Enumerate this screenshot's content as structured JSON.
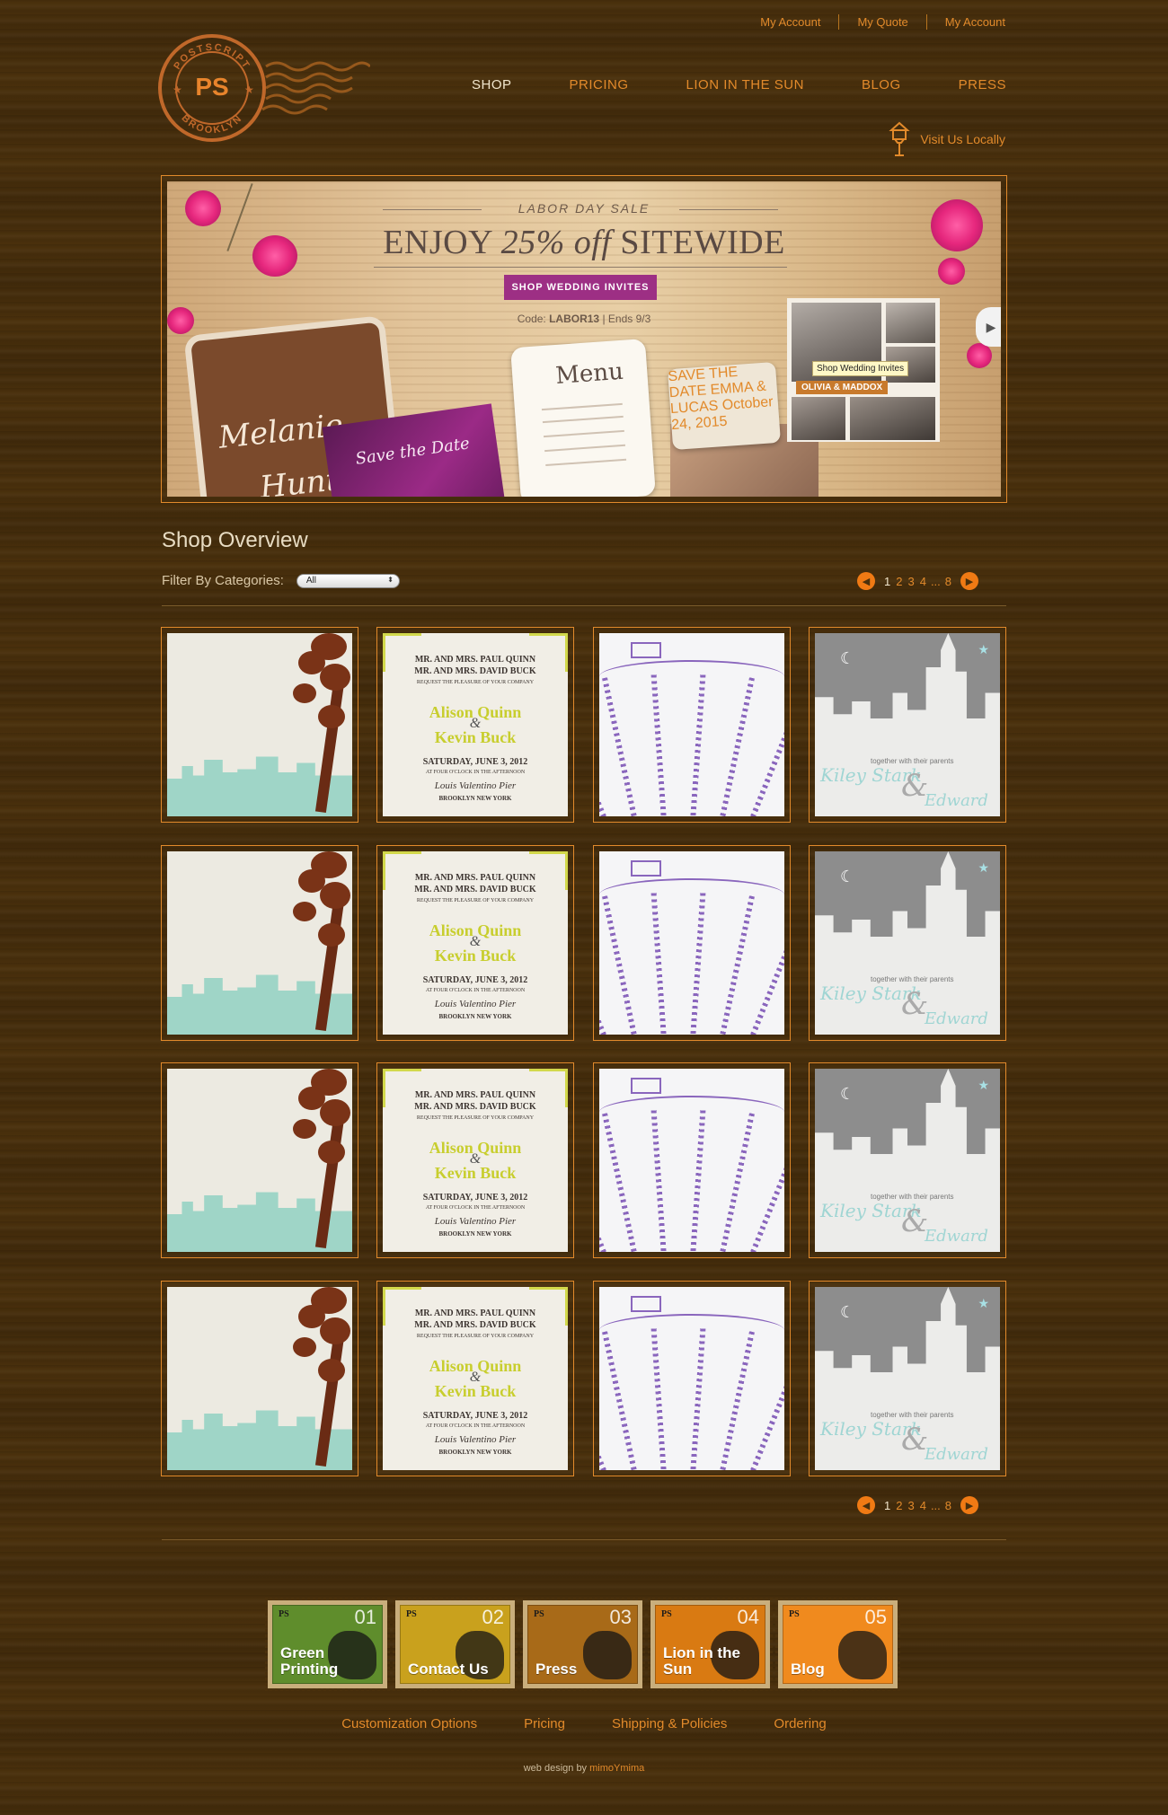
{
  "header": {
    "account_links": [
      "My Account",
      "My Quote",
      "My Account"
    ],
    "logo": {
      "top": "POSTSCRIPT",
      "mono": "PS",
      "bottom": "BROOKLYN"
    },
    "nav": [
      {
        "label": "SHOP",
        "active": true
      },
      {
        "label": "PRICING",
        "active": false
      },
      {
        "label": "LION IN THE SUN",
        "active": false
      },
      {
        "label": "BLOG",
        "active": false
      },
      {
        "label": "PRESS",
        "active": false
      }
    ],
    "visit_label": "Visit Us Locally"
  },
  "banner": {
    "kicker": "LABOR DAY SALE",
    "headline_pre": "ENJOY ",
    "headline_em": "25% off",
    "headline_post": " SITEWIDE",
    "button": "SHOP WEDDING INVITES",
    "code_prefix": "Code: ",
    "code": "LABOR13",
    "code_suffix": " | Ends 9/3",
    "card_name_1": "Melanie",
    "card_name_2": "Hunter",
    "save_the_date": "Save the Date",
    "menu_title": "Menu",
    "save_card": "SAVE THE DATE EMMA & LUCAS October 24, 2015",
    "collage_tag": "OLIVIA & MADDOX",
    "collage_tip": "Shop Wedding Invites"
  },
  "shop": {
    "title": "Shop Overview",
    "filter_label": "Filter By Categories:",
    "filter_value": "All"
  },
  "pagination": {
    "prev": "◀",
    "pages": [
      "1",
      "2",
      "3",
      "4"
    ],
    "ellipsis": "...",
    "last": "8",
    "next": "▶",
    "current": "1"
  },
  "products": {
    "quinn": {
      "l1": "MR. AND MRS. PAUL QUINN",
      "l2": "MR. AND MRS. DAVID BUCK",
      "l3": "REQUEST THE PLEASURE OF YOUR COMPANY",
      "n1": "Alison Quinn",
      "amp": "&",
      "n2": "Kevin Buck",
      "date": "SATURDAY, JUNE 3, 2012",
      "time": "AT FOUR O'CLOCK IN THE AFTERNOON",
      "place": "Louis Valentino Pier",
      "city": "BROOKLYN NEW YORK"
    },
    "city": {
      "together": "together with their parents",
      "n1": "Kiley Stark",
      "amp": "&",
      "n2": "Edward"
    }
  },
  "footer": {
    "stamps": [
      {
        "num": "01",
        "label": "Green Printing",
        "color": "#5f8d2c",
        "ps": "PS"
      },
      {
        "num": "02",
        "label": "Contact Us",
        "color": "#c9a11d",
        "ps": "PS"
      },
      {
        "num": "03",
        "label": "Press",
        "color": "#a86a18",
        "ps": "PS"
      },
      {
        "num": "04",
        "label": "Lion in the Sun",
        "color": "#d97a12",
        "ps": "PS"
      },
      {
        "num": "05",
        "label": "Blog",
        "color": "#f08a1e",
        "ps": "PS"
      }
    ],
    "links": [
      "Customization Options",
      "Pricing",
      "Shipping & Policies",
      "Ordering"
    ],
    "credit_prefix": "web design by ",
    "credit_link": "mimoYmima"
  },
  "colors": {
    "accent": "#e28a2b",
    "wood": "#4a300c",
    "cream": "#f2e6cc",
    "button_purple": "#9d2f84"
  }
}
